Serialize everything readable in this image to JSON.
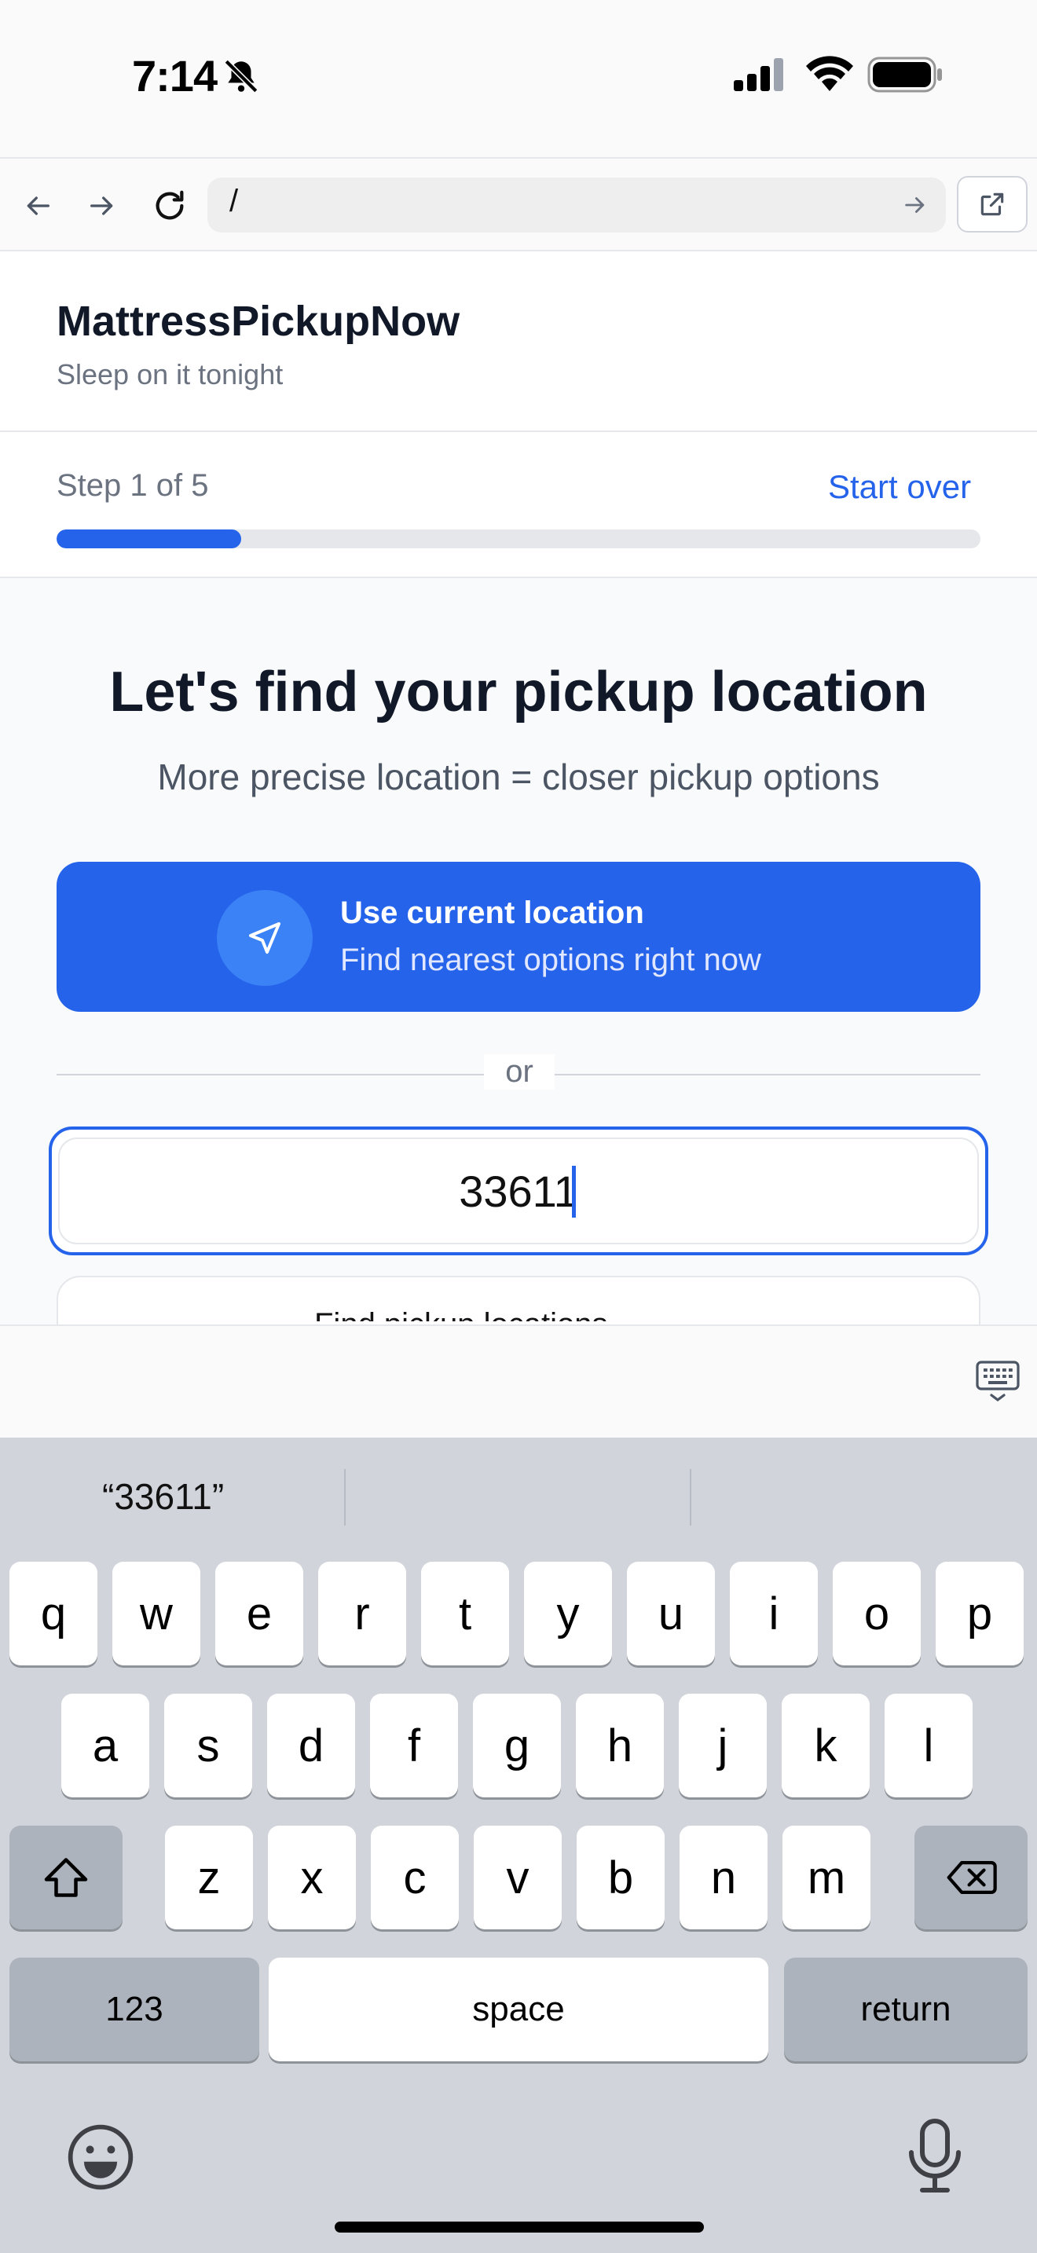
{
  "status_bar": {
    "time": "7:14"
  },
  "browser": {
    "url": "/"
  },
  "header": {
    "brand": "MattressPickupNow",
    "tagline": "Sleep on it tonight"
  },
  "progress": {
    "step_label": "Step 1 of 5",
    "start_over": "Start over",
    "step": 1,
    "total_steps": 5
  },
  "main": {
    "headline": "Let's find your pickup location",
    "subhead": "More precise location = closer pickup options",
    "use_location_title": "Use current location",
    "use_location_subtitle": "Find nearest options right now",
    "or": "or",
    "zip_value": "33611",
    "find_label": "Find pickup locations"
  },
  "keyboard": {
    "suggestions": [
      "“33611”",
      "",
      ""
    ],
    "row1": [
      "q",
      "w",
      "e",
      "r",
      "t",
      "y",
      "u",
      "i",
      "o",
      "p"
    ],
    "row2": [
      "a",
      "s",
      "d",
      "f",
      "g",
      "h",
      "j",
      "k",
      "l"
    ],
    "row3": [
      "z",
      "x",
      "c",
      "v",
      "b",
      "n",
      "m"
    ],
    "numbers_key": "123",
    "space_key": "space",
    "return_key": "return"
  },
  "colors": {
    "accent": "#2563eb",
    "keyboard_bg": "#d1d5db"
  }
}
